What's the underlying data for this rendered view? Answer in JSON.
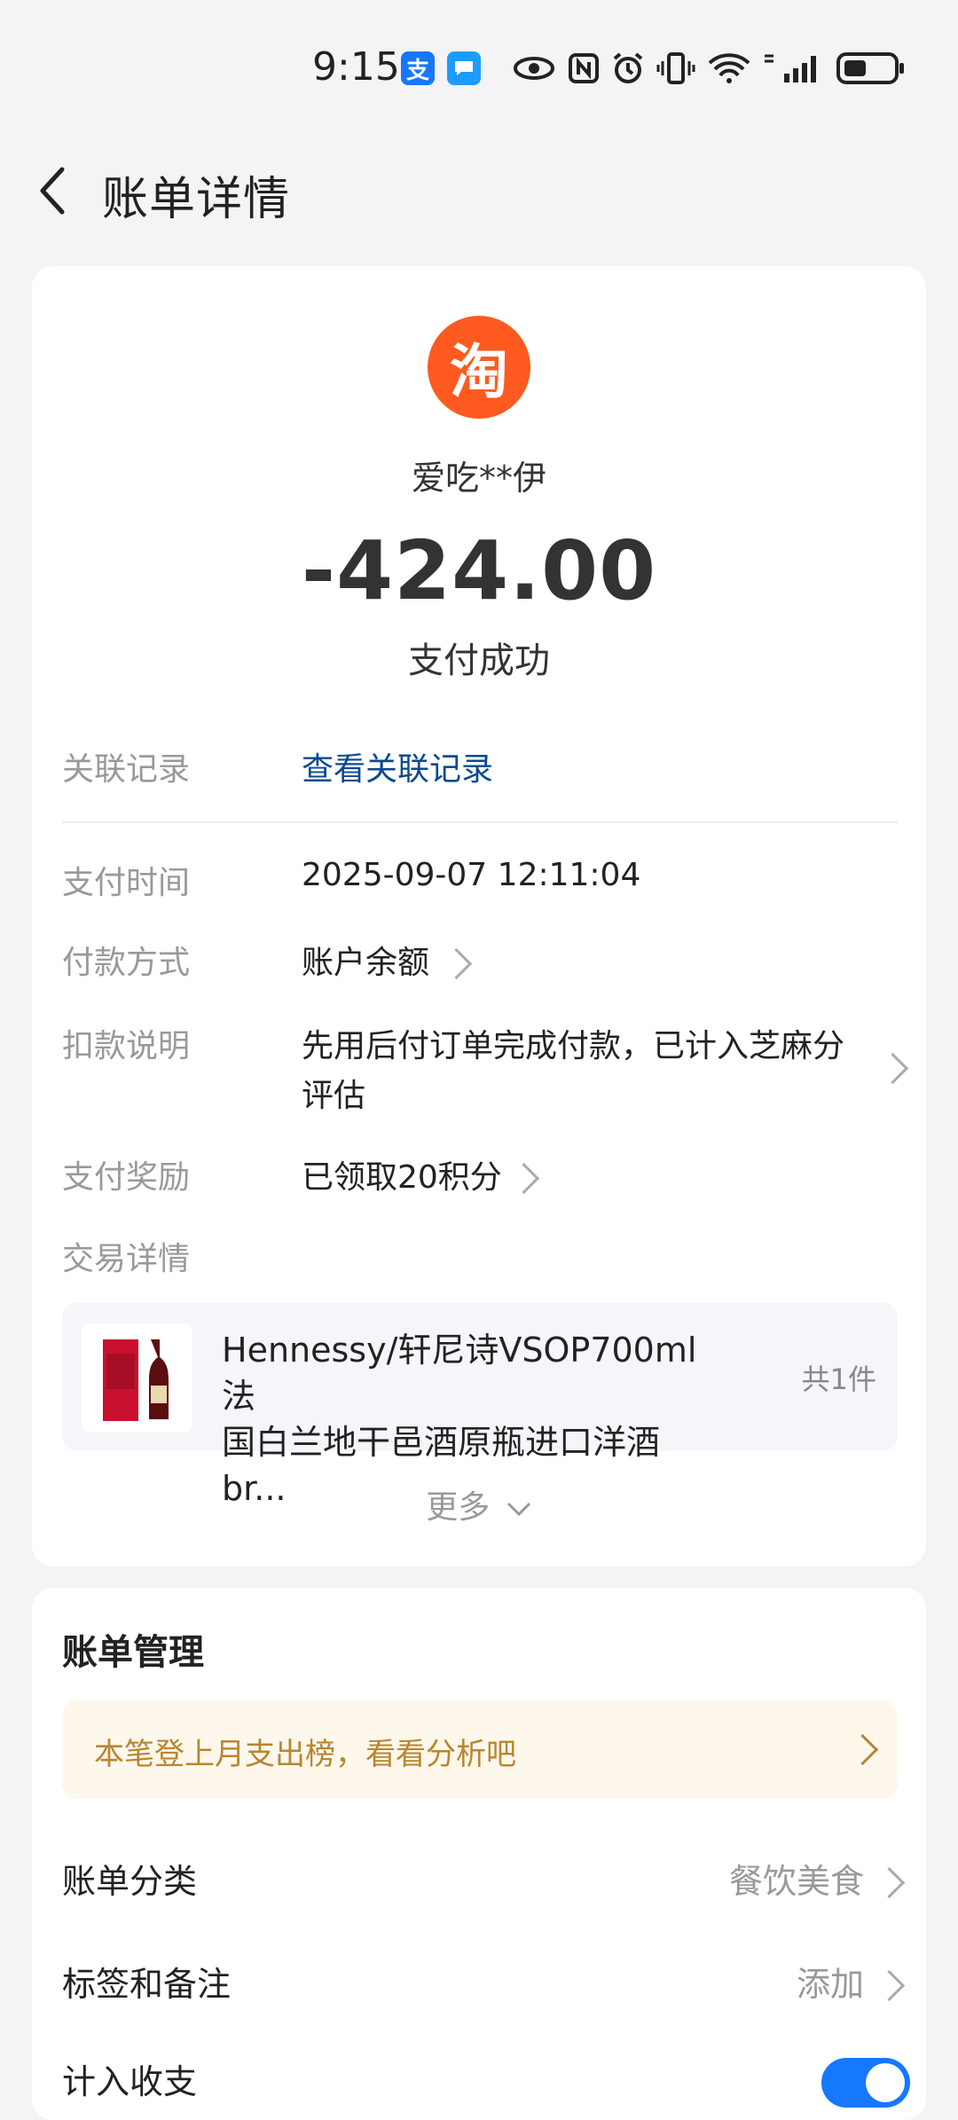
{
  "status_bar": {
    "time": "9:15"
  },
  "nav": {
    "title": "账单详情"
  },
  "summary": {
    "merchant_logo": "淘",
    "merchant": "爱吃**伊",
    "amount": "-424.00",
    "status": "支付成功"
  },
  "details": {
    "related_label": "关联记录",
    "related_link": "查看关联记录",
    "pay_time_label": "支付时间",
    "pay_time": "2025-09-07 12:11:04",
    "method_label": "付款方式",
    "method": "账户余额",
    "note_label": "扣款说明",
    "note_line1": "先用后付订单完成付款，已计入芝麻分",
    "note_line2": "评估",
    "reward_label": "支付奖励",
    "reward": "已领取20积分",
    "trade_label": "交易详情"
  },
  "product": {
    "title_line1": "Hennessy/轩尼诗VSOP700ml法",
    "title_line2": "国白兰地干邑酒原瓶进口洋酒br...",
    "qty": "共1件"
  },
  "more_label": "更多",
  "bill_mgmt": {
    "title": "账单管理",
    "banner": "本笔登上月支出榜，看看分析吧",
    "category_label": "账单分类",
    "category_value": "餐饮美食",
    "tags_label": "标签和备注",
    "tags_value": "添加",
    "income_label": "计入收支"
  },
  "colors": {
    "accent": "#1677ff",
    "taobao": "#ff5a1f",
    "link": "#0b4a8f",
    "banner_text": "#b8862f"
  }
}
